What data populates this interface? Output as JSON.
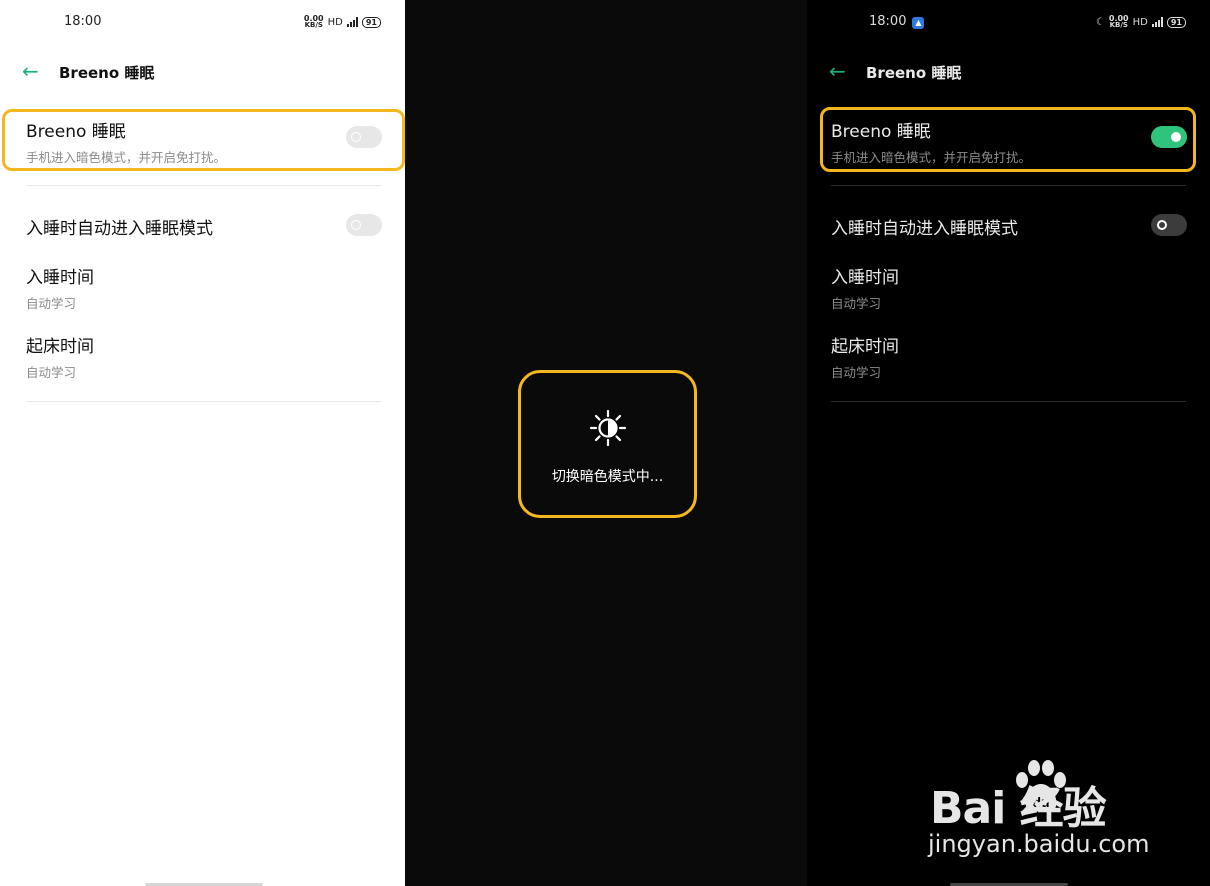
{
  "left_screen": {
    "status_bar": {
      "time": "18:00",
      "net_rate": "0.00",
      "net_unit": "KB/S",
      "hd": "HD",
      "signal": "5G",
      "battery": "91"
    },
    "header": {
      "title": "Breeno 睡眠"
    },
    "breeno_sleep": {
      "label": "Breeno 睡眠",
      "sub": "手机进入暗色模式，并开启免打扰。",
      "enabled": false
    },
    "auto_sleep": {
      "label": "入睡时自动进入睡眠模式",
      "enabled": false
    },
    "bedtime": {
      "label": "入睡时间",
      "sub": "自动学习"
    },
    "wake_time": {
      "label": "起床时间",
      "sub": "自动学习"
    }
  },
  "middle_screen": {
    "toast": {
      "icon": "brightness-icon",
      "message": "切换暗色模式中..."
    }
  },
  "right_screen": {
    "status_bar": {
      "time": "18:00",
      "net_rate": "0.00",
      "net_unit": "KB/S",
      "hd": "HD",
      "signal": "5G",
      "battery": "91"
    },
    "header": {
      "title": "Breeno 睡眠"
    },
    "breeno_sleep": {
      "label": "Breeno 睡眠",
      "sub": "手机进入暗色模式，并开启免打扰。",
      "enabled": true
    },
    "auto_sleep": {
      "label": "入睡时自动进入睡眠模式",
      "enabled": false
    },
    "bedtime": {
      "label": "入睡时间",
      "sub": "自动学习"
    },
    "wake_time": {
      "label": "起床时间",
      "sub": "自动学习"
    }
  },
  "watermark": {
    "brand": "Bai  经验",
    "url": "jingyan.baidu.com"
  },
  "colors": {
    "accent_green": "#2fc47c",
    "highlight_yellow": "#f4b81e"
  }
}
